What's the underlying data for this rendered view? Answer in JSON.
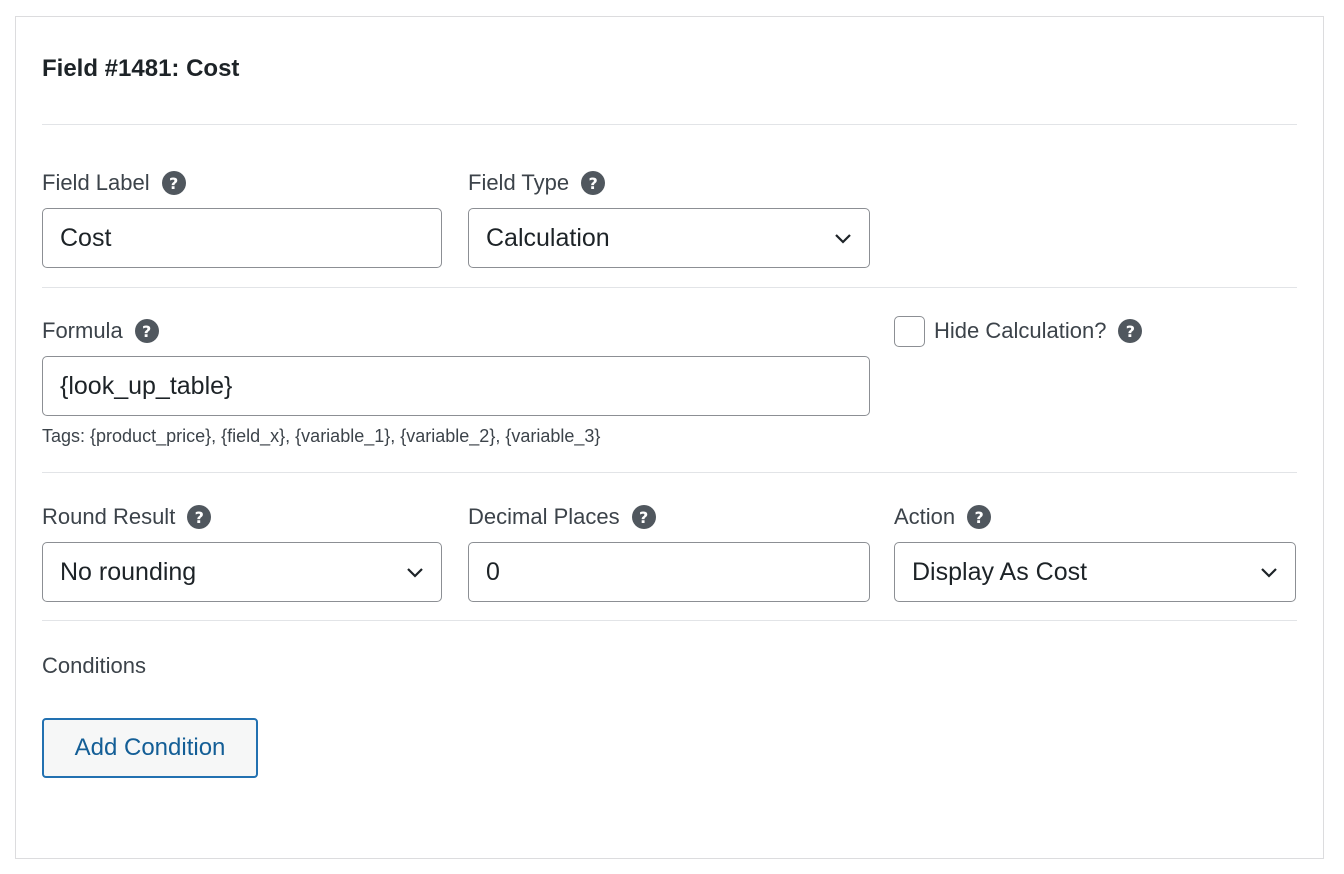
{
  "panel": {
    "title": "Field #1481: Cost"
  },
  "field_label": {
    "label": "Field Label",
    "value": "Cost"
  },
  "field_type": {
    "label": "Field Type",
    "selected": "Calculation"
  },
  "formula": {
    "label": "Formula",
    "value": "{look_up_table}",
    "tags": "Tags: {product_price}, {field_x}, {variable_1}, {variable_2}, {variable_3}"
  },
  "hide_calculation": {
    "label": "Hide Calculation?",
    "checked": false
  },
  "round_result": {
    "label": "Round Result",
    "selected": "No rounding"
  },
  "decimal_places": {
    "label": "Decimal Places",
    "value": "0"
  },
  "action": {
    "label": "Action",
    "selected": "Display As Cost"
  },
  "conditions": {
    "label": "Conditions",
    "add_button": "Add Condition"
  },
  "icons": {
    "help": "question-circle-icon",
    "chevron": "chevron-down-icon"
  },
  "colors": {
    "accent": "#2271b1",
    "button_text": "#135e96",
    "help_icon": "#50575e",
    "border": "#8c8f94"
  }
}
